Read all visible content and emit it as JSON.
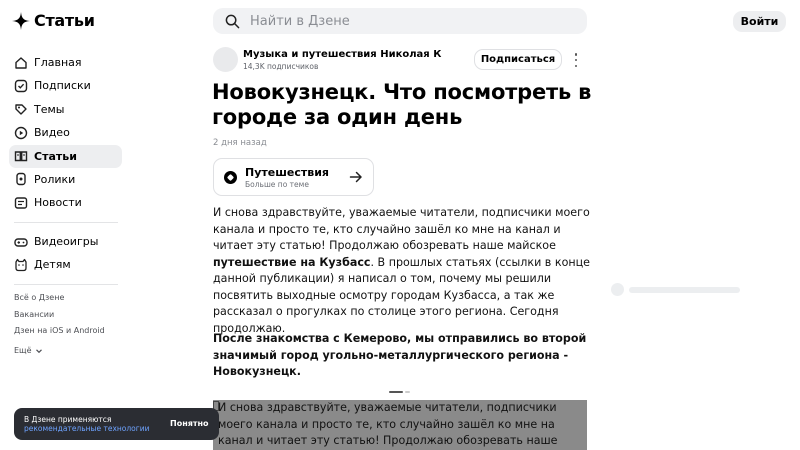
{
  "header": {
    "logo_text": "Статьи",
    "search_placeholder": "Найти в Дзене",
    "login_label": "Войти"
  },
  "sidebar": {
    "items": [
      {
        "label": "Главная",
        "icon": "home-icon"
      },
      {
        "label": "Подписки",
        "icon": "subscriptions-icon"
      },
      {
        "label": "Темы",
        "icon": "topics-icon"
      },
      {
        "label": "Видео",
        "icon": "video-icon"
      },
      {
        "label": "Статьи",
        "icon": "articles-icon",
        "active": true
      },
      {
        "label": "Ролики",
        "icon": "shorts-icon"
      },
      {
        "label": "Новости",
        "icon": "news-icon"
      }
    ],
    "items2": [
      {
        "label": "Видеоигры",
        "icon": "gamepad-icon"
      },
      {
        "label": "Детям",
        "icon": "kids-icon"
      }
    ],
    "footer": {
      "about": "Всё о Дзене",
      "jobs": "Вакансии",
      "apps": "Дзен на iOS и Android",
      "more": "Ещё"
    }
  },
  "article": {
    "channel_name": "Музыка и путешествия Николая К",
    "channel_subs": "14,3K подписчиков",
    "subscribe_label": "Подписаться",
    "title": "Новокузнецк. Что посмотреть в городе за один день",
    "date": "2 дня назад",
    "topic": {
      "name": "Путешествия",
      "sub": "Больше по теме"
    },
    "para1_a": "И снова здравствуйте, уважаемые читатели, подписчики моего канала и просто те, кто случайно зашёл ко мне на канал и читает эту статью! Продолжаю обозревать наше майское ",
    "para1_bold": "путешествие на Кузбасс",
    "para1_b": ". В прошлых статьях (ссылки в конце данной публикации) я написал о том, почему мы решили посвятить выходные осмотру городам Кузбасса, а так же рассказал о прогулках по столице этого региона. Сегодня продолжаю.",
    "para2": "После знакомства с Кемерово, мы отправились во второй значимый город угольно-металлургического региона - Новокузнецк.",
    "image_alt": "И снова здравствуйте, уважаемые читатели, подписчики моего канала и просто те, кто случайно зашёл ко мне на канал и читает эту статью! Продолжаю обозревать наше майское путешествие на"
  },
  "cookie": {
    "line1": "В Дзене применяются",
    "link": "рекомендательные технологии",
    "ok_label": "Понятно"
  },
  "colors": {
    "accent_link": "#6ea3ff",
    "toast_bg": "#2b2d33",
    "image_bg": "#8a8a8a"
  }
}
